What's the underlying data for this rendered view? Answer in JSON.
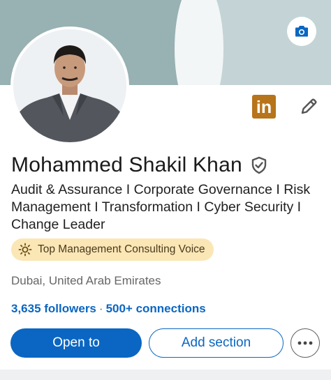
{
  "profile": {
    "name": "Mohammed Shakil Khan",
    "headline": "Audit & Assurance I Corporate Governance I Risk Management I Transformation I Cyber Security I Change Leader",
    "voice_badge": "Top Management Consulting Voice",
    "location": "Dubai, United Arab Emirates",
    "followers": "3,635 followers",
    "separator": "·",
    "connections": "500+ connections"
  },
  "icons": {
    "camera": "camera-icon",
    "linkedin": "linkedin-icon",
    "edit": "pencil-icon",
    "verified": "shield-check-icon",
    "voice": "sun-icon",
    "more": "ellipsis-icon"
  },
  "linkedin_badge_text": "in",
  "actions": {
    "primary_label": "Open to",
    "secondary_label": "Add section"
  },
  "colors": {
    "accent": "#0a66c2",
    "banner_light": "#c4d4d6",
    "banner_dark": "#98b1b3",
    "voice_badge_bg": "#fbe6b6",
    "linkedin_badge": "#b8741a"
  }
}
